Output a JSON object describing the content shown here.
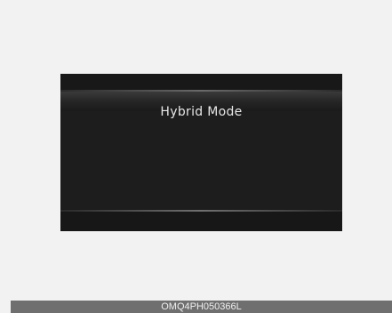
{
  "display": {
    "title": "Hybrid Mode"
  },
  "caption": {
    "code": "OMQ4PH050366L"
  }
}
